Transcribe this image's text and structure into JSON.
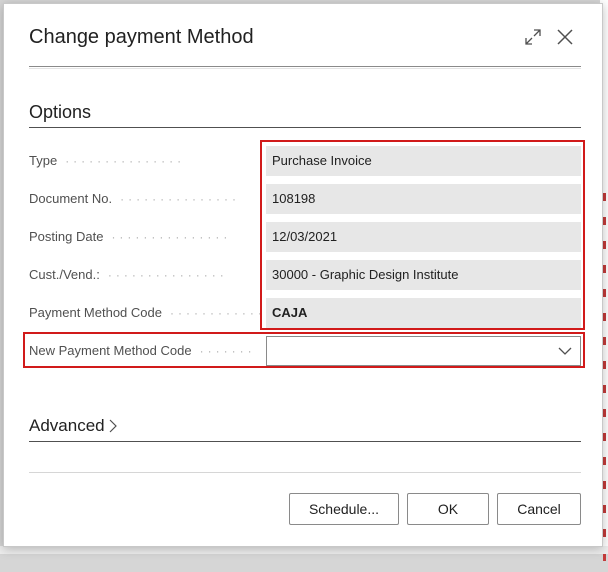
{
  "dialog": {
    "title": "Change payment Method",
    "expand_icon": "expand-icon",
    "close_icon": "close-icon"
  },
  "options": {
    "section_title": "Options",
    "fields": [
      {
        "label": "Type",
        "value": "Purchase Invoice"
      },
      {
        "label": "Document No.",
        "value": "108198"
      },
      {
        "label": "Posting Date",
        "value": "12/03/2021"
      },
      {
        "label": "Cust./Vend.:",
        "value": "30000 - Graphic Design Institute"
      },
      {
        "label": "Payment Method Code",
        "value": "CAJA"
      }
    ],
    "new_method": {
      "label": "New Payment Method Code",
      "value": ""
    }
  },
  "advanced": {
    "label": "Advanced"
  },
  "footer": {
    "schedule_label": "Schedule...",
    "ok_label": "OK",
    "cancel_label": "Cancel"
  },
  "colors": {
    "highlight": "#d11a1a",
    "field_bg": "#e7e7e7"
  }
}
